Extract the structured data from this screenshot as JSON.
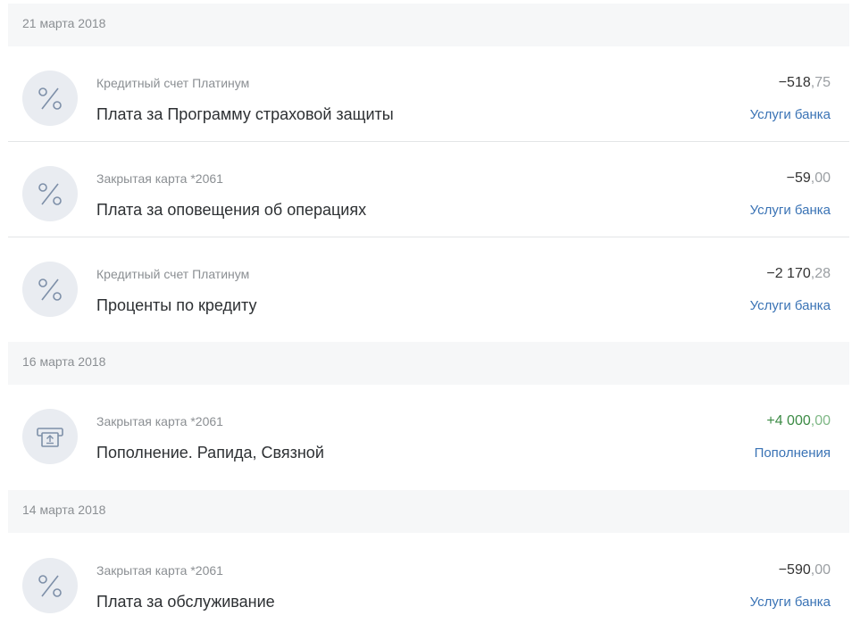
{
  "groups": [
    {
      "date": "21 марта 2018",
      "transactions": [
        {
          "account": "Кредитный счет Платинум",
          "title": "Плата за Программу страховой защиты",
          "amount_main": "−518",
          "amount_cents": ",75",
          "category": "Услуги банка",
          "icon": "percent-icon"
        },
        {
          "account": "Закрытая карта *2061",
          "title": "Плата за оповещения об операциях",
          "amount_main": "−59",
          "amount_cents": ",00",
          "category": "Услуги банка",
          "icon": "percent-icon"
        },
        {
          "account": "Кредитный счет Платинум",
          "title": "Проценты по кредиту",
          "amount_main": "−2 170",
          "amount_cents": ",28",
          "category": "Услуги банка",
          "icon": "percent-icon"
        }
      ]
    },
    {
      "date": "16 марта 2018",
      "transactions": [
        {
          "account": "Закрытая карта *2061",
          "title": "Пополнение. Рапида, Связной",
          "amount_main": "+4 000",
          "amount_cents": ",00",
          "category": "Пополнения",
          "icon": "atm-deposit-icon"
        }
      ]
    },
    {
      "date": "14 марта 2018",
      "transactions": [
        {
          "account": "Закрытая карта *2061",
          "title": "Плата за обслуживание",
          "amount_main": "−590",
          "amount_cents": ",00",
          "category": "Услуги банка",
          "icon": "percent-icon"
        }
      ]
    }
  ],
  "colors": {
    "positive": "#3c8b45",
    "category_link": "#3a73b5",
    "icon_bg": "#e9ecf1"
  }
}
